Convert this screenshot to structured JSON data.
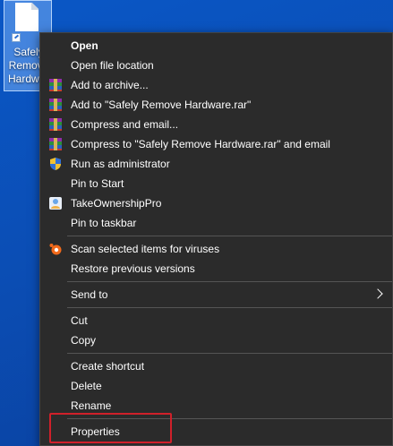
{
  "desktop": {
    "icon_label": "Safely\nRemove\nHardware",
    "background_color": "#0b4eb5"
  },
  "menu": {
    "items": [
      {
        "label": "Open",
        "bold": true,
        "icon": ""
      },
      {
        "label": "Open file location",
        "icon": ""
      },
      {
        "label": "Add to archive...",
        "icon": "winrar-icon"
      },
      {
        "label": "Add to \"Safely Remove Hardware.rar\"",
        "icon": "winrar-icon"
      },
      {
        "label": "Compress and email...",
        "icon": "winrar-icon"
      },
      {
        "label": "Compress to \"Safely Remove Hardware.rar\" and email",
        "icon": "winrar-icon"
      },
      {
        "label": "Run as administrator",
        "icon": "uac-shield-icon"
      },
      {
        "label": "Pin to Start",
        "icon": ""
      },
      {
        "label": "TakeOwnershipPro",
        "icon": "takeownershippro-icon"
      },
      {
        "label": "Pin to taskbar",
        "icon": ""
      },
      {
        "label": "Scan selected items for viruses",
        "icon": "avast-icon"
      },
      {
        "label": "Restore previous versions",
        "icon": ""
      },
      {
        "label": "Send to",
        "icon": "",
        "submenu": true
      },
      {
        "label": "Cut",
        "icon": ""
      },
      {
        "label": "Copy",
        "icon": ""
      },
      {
        "label": "Create shortcut",
        "icon": ""
      },
      {
        "label": "Delete",
        "icon": ""
      },
      {
        "label": "Rename",
        "icon": ""
      },
      {
        "label": "Properties",
        "icon": "",
        "highlighted": true
      }
    ],
    "background_color": "#2b2b2b",
    "highlight_color": "#d0202a"
  }
}
